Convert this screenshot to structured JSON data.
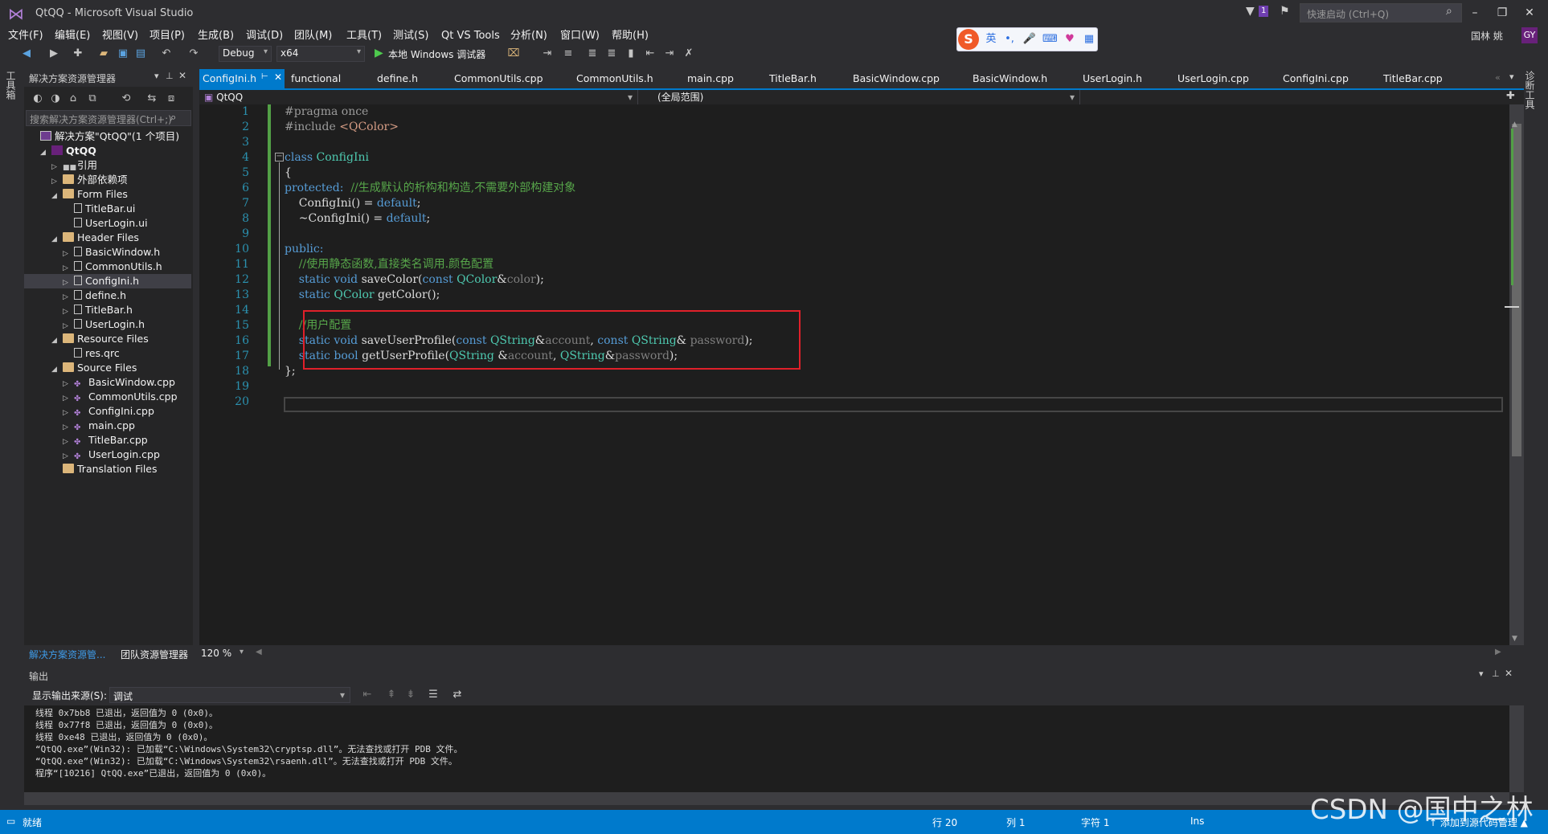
{
  "window": {
    "title": "QtQQ - Microsoft Visual Studio",
    "quick_launch_placeholder": "快速启动 (Ctrl+Q)",
    "notification_count": "1",
    "user_name": "国林 姚",
    "user_avatar": "GY"
  },
  "menu": [
    "文件(F)",
    "编辑(E)",
    "视图(V)",
    "项目(P)",
    "生成(B)",
    "调试(D)",
    "团队(M)",
    "工具(T)",
    "测试(S)",
    "Qt VS Tools",
    "分析(N)",
    "窗口(W)",
    "帮助(H)"
  ],
  "ime": {
    "logo": "S",
    "lang": "英"
  },
  "toolbar": {
    "config": "Debug",
    "platform": "x64",
    "run_label": "本地 Windows 调试器"
  },
  "side_strips": {
    "left": "工具箱",
    "right": "诊断工具"
  },
  "solution_explorer": {
    "title": "解决方案资源管理器",
    "search_placeholder": "搜索解决方案资源管理器(Ctrl+;)",
    "tree": [
      {
        "label": "解决方案\"QtQQ\"(1 个项目)",
        "level": 0,
        "icon": "solution-icon"
      },
      {
        "label": "QtQQ",
        "level": 1,
        "icon": "project-icon",
        "bold": true
      },
      {
        "label": "引用",
        "level": 2,
        "icon": "references-icon"
      },
      {
        "label": "外部依赖项",
        "level": 2,
        "icon": "folder-icon"
      },
      {
        "label": "Form Files",
        "level": 2,
        "icon": "folder-icon"
      },
      {
        "label": "TitleBar.ui",
        "level": 3,
        "icon": "file-icon"
      },
      {
        "label": "UserLogin.ui",
        "level": 3,
        "icon": "file-icon"
      },
      {
        "label": "Header Files",
        "level": 2,
        "icon": "folder-icon"
      },
      {
        "label": "BasicWindow.h",
        "level": 3,
        "icon": "header-file-icon"
      },
      {
        "label": "CommonUtils.h",
        "level": 3,
        "icon": "header-file-icon"
      },
      {
        "label": "ConfigIni.h",
        "level": 3,
        "icon": "header-file-icon"
      },
      {
        "label": "define.h",
        "level": 3,
        "icon": "header-file-icon"
      },
      {
        "label": "TitleBar.h",
        "level": 3,
        "icon": "header-file-icon"
      },
      {
        "label": "UserLogin.h",
        "level": 3,
        "icon": "header-file-icon"
      },
      {
        "label": "Resource Files",
        "level": 2,
        "icon": "folder-icon"
      },
      {
        "label": "res.qrc",
        "level": 3,
        "icon": "file-icon"
      },
      {
        "label": "Source Files",
        "level": 2,
        "icon": "folder-icon"
      },
      {
        "label": "BasicWindow.cpp",
        "level": 3,
        "icon": "cpp-file-icon"
      },
      {
        "label": "CommonUtils.cpp",
        "level": 3,
        "icon": "cpp-file-icon"
      },
      {
        "label": "ConfigIni.cpp",
        "level": 3,
        "icon": "cpp-file-icon"
      },
      {
        "label": "main.cpp",
        "level": 3,
        "icon": "cpp-file-icon"
      },
      {
        "label": "TitleBar.cpp",
        "level": 3,
        "icon": "cpp-file-icon"
      },
      {
        "label": "UserLogin.cpp",
        "level": 3,
        "icon": "cpp-file-icon"
      },
      {
        "label": "Translation Files",
        "level": 2,
        "icon": "folder-icon"
      }
    ],
    "bottom_tabs": [
      "解决方案资源管...",
      "团队资源管理器"
    ]
  },
  "editor": {
    "tabs": [
      "ConfigIni.h",
      "functional",
      "define.h",
      "CommonUtils.cpp",
      "CommonUtils.h",
      "main.cpp",
      "TitleBar.h",
      "BasicWindow.cpp",
      "BasicWindow.h",
      "UserLogin.h",
      "UserLogin.cpp",
      "ConfigIni.cpp",
      "TitleBar.cpp"
    ],
    "active_tab": "ConfigIni.h",
    "nav_project": "QtQQ",
    "nav_scope": "(全局范围)",
    "zoom": "120 %",
    "line_numbers": [
      "1",
      "2",
      "3",
      "4",
      "5",
      "6",
      "7",
      "8",
      "9",
      "10",
      "11",
      "12",
      "13",
      "14",
      "15",
      "16",
      "17",
      "18",
      "19",
      "20"
    ],
    "code": {
      "l1": "#pragma once",
      "l2a": "#include ",
      "l2b": "<QColor>",
      "l4a": "class ",
      "l4b": "ConfigIni",
      "l5": "{",
      "l6a": "protected:",
      "l6b": "  //生成默认的析构和构造,不需要外部构建对象",
      "l7a": "    ConfigIni() = ",
      "l7b": "default",
      "l7c": ";",
      "l8a": "    ~ConfigIni() = ",
      "l8b": "default",
      "l8c": ";",
      "l10": "public:",
      "l11": "    //使用静态函数,直接类名调用.颜色配置",
      "l12a": "    static ",
      "l12b": "void",
      "l12c": " saveColor(",
      "l12d": "const ",
      "l12e": "QColor",
      "l12f": "&",
      "l12g": "color",
      "l12h": ");",
      "l13a": "    static ",
      "l13b": "QColor",
      "l13c": " getColor();",
      "l15": "    //用户配置",
      "l16a": "    static ",
      "l16b": "void",
      "l16c": " saveUserProfile(",
      "l16d": "const ",
      "l16e": "QString",
      "l16f": "&",
      "l16g": "account",
      "l16h": ", ",
      "l16i": "const ",
      "l16j": "QString",
      "l16k": "& ",
      "l16l": "password",
      "l16m": ");",
      "l17a": "    static ",
      "l17b": "bool",
      "l17c": " getUserProfile(",
      "l17d": "QString",
      "l17e": " &",
      "l17f": "account",
      "l17g": ", ",
      "l17h": "QString",
      "l17i": "&",
      "l17j": "password",
      "l17k": ");",
      "l18": "};"
    }
  },
  "output": {
    "title": "输出",
    "source_label": "显示输出来源(S):",
    "source_value": "调试",
    "lines": [
      "线程 0x7bb8 已退出，返回值为 0 (0x0)。",
      "线程 0x77f8 已退出，返回值为 0 (0x0)。",
      "线程 0xe48 已退出，返回值为 0 (0x0)。",
      "“QtQQ.exe”(Win32): 已加载“C:\\Windows\\System32\\cryptsp.dll”。无法查找或打开 PDB 文件。",
      "“QtQQ.exe”(Win32): 已加载“C:\\Windows\\System32\\rsaenh.dll”。无法查找或打开 PDB 文件。",
      "程序“[10216] QtQQ.exe”已退出，返回值为 0 (0x0)。"
    ]
  },
  "status": {
    "ready": "就绪",
    "line": "行 20",
    "col": "列 1",
    "char": "字符 1",
    "mode": "Ins",
    "source_control": "↑ 添加到源代码管理 ▲"
  },
  "watermark": "CSDN @国中之林",
  "colors": {
    "accent": "#007acc",
    "highlight_box": "#e0202a",
    "keyword": "#569cd6",
    "type": "#4ec9b0",
    "comment": "#57a64a",
    "string": "#d69d85"
  }
}
